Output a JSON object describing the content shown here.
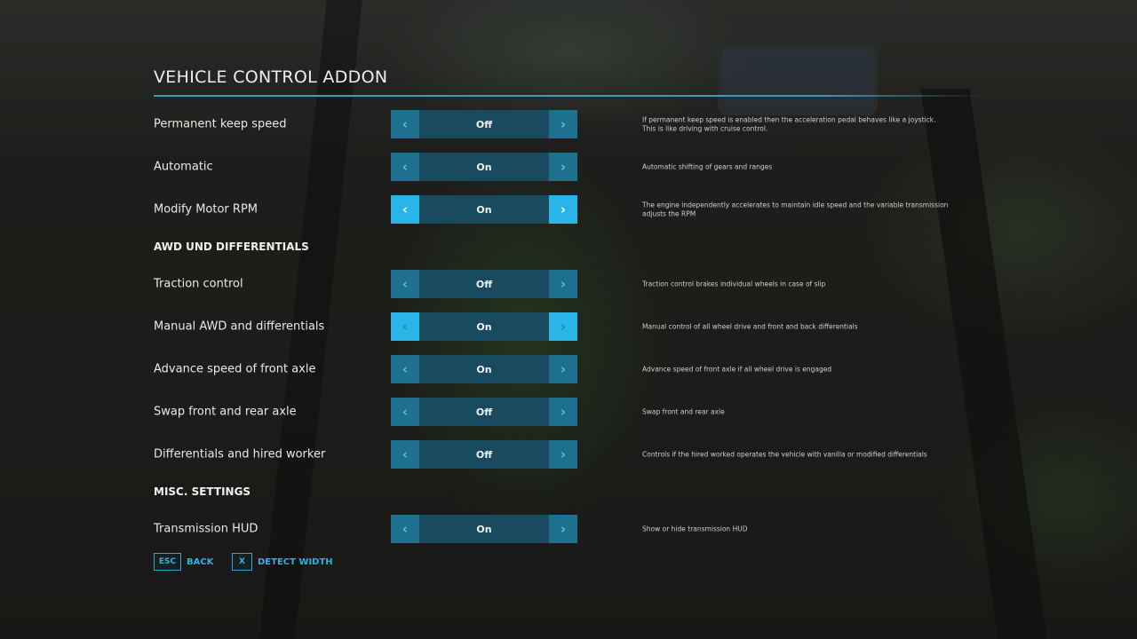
{
  "title": "VEHICLE CONTROL ADDON",
  "accent_color": "#2ab5e8",
  "rows": [
    {
      "type": "option",
      "label": "Permanent keep speed",
      "value": "Off",
      "description": "If permanent keep speed is enabled then the acceleration pedal behaves like a joystick. This is like driving with cruise control.",
      "state": "normal",
      "left_icon": "chevron-left-icon",
      "right_icon": "chevron-right-icon"
    },
    {
      "type": "option",
      "label": "Automatic",
      "value": "On",
      "description": "Automatic shifting of gears and ranges",
      "state": "normal",
      "left_icon": "chevron-left-icon",
      "right_icon": "chevron-right-icon"
    },
    {
      "type": "option",
      "label": "Modify Motor RPM",
      "value": "On",
      "description": "The engine independently accelerates to maintain idle speed and the variable transmission adjusts the RPM",
      "state": "focused",
      "left_icon": "chevron-left-icon",
      "right_icon": "chevron-right-icon"
    },
    {
      "type": "section",
      "label": "AWD UND DIFFERENTIALS"
    },
    {
      "type": "option",
      "label": "Traction control",
      "value": "Off",
      "description": "Traction control brakes individual wheels in case of slip",
      "state": "normal",
      "left_icon": "chevron-left-icon",
      "right_icon": "chevron-right-icon"
    },
    {
      "type": "option",
      "label": "Manual AWD and differentials",
      "value": "On",
      "description": "Manual control of all wheel drive and front and back differentials",
      "state": "hover",
      "left_icon": "chevron-left-icon",
      "right_icon": "chevron-right-icon"
    },
    {
      "type": "option",
      "label": "Advance speed of front axle",
      "value": "On",
      "description": "Advance speed of front axle if all wheel drive is engaged",
      "state": "normal",
      "left_icon": "chevron-left-icon",
      "right_icon": "chevron-right-icon"
    },
    {
      "type": "option",
      "label": "Swap front and rear axle",
      "value": "Off",
      "description": "Swap front and rear axle",
      "state": "normal",
      "left_icon": "chevron-left-icon",
      "right_icon": "chevron-right-icon"
    },
    {
      "type": "option",
      "label": "Differentials and hired worker",
      "value": "Off",
      "description": "Controls if the hired worked operates the vehicle with vanilla or modified differentials",
      "state": "normal",
      "left_icon": "chevron-left-icon",
      "right_icon": "chevron-right-icon"
    },
    {
      "type": "section",
      "label": "MISC. SETTINGS"
    },
    {
      "type": "option",
      "label": "Transmission HUD",
      "value": "On",
      "description": "Show or hide transmission HUD",
      "state": "normal",
      "left_icon": "chevron-left-icon",
      "right_icon": "chevron-right-icon"
    }
  ],
  "footer": {
    "back": {
      "key": "ESC",
      "label": "BACK"
    },
    "detect": {
      "key": "X",
      "label": "DETECT WIDTH"
    }
  },
  "icons": {
    "left": "‹",
    "right": "›"
  }
}
